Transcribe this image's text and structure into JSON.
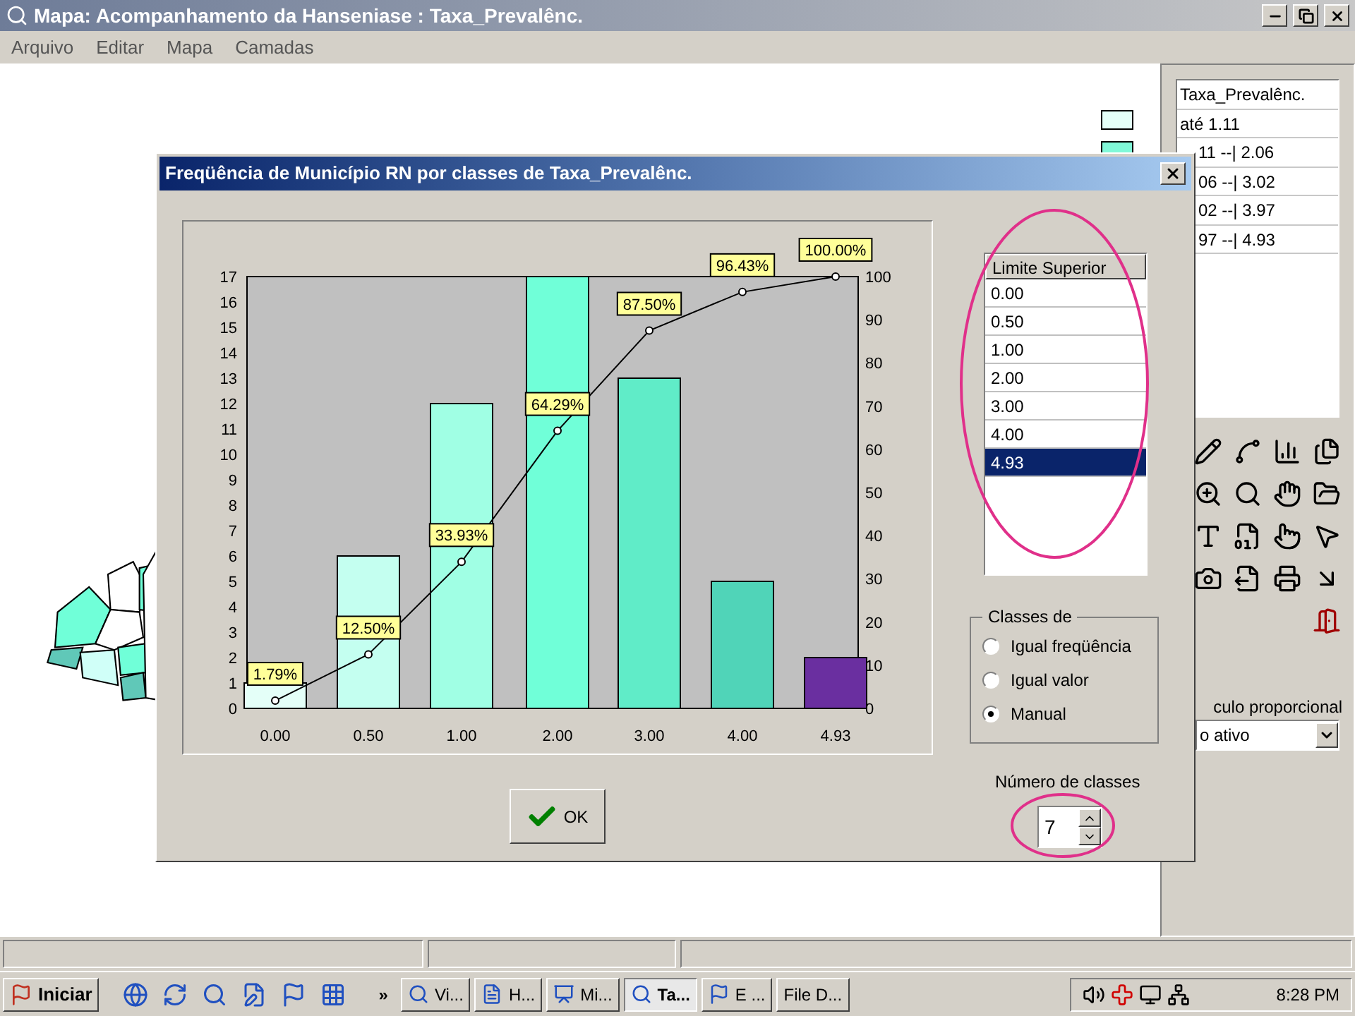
{
  "window": {
    "title": "Mapa: Acompanhamento da Hanseniase : Taxa_Prevalênc."
  },
  "menu": [
    "Arquivo",
    "Editar",
    "Mapa",
    "Camadas"
  ],
  "map_legend": [
    {
      "color": "#e4fff8"
    },
    {
      "color": "#80f8d8"
    }
  ],
  "legend_list": [
    "Taxa_Prevalênc.",
    "até 1.11",
    "11 --| 2.06",
    "06 --| 3.02",
    "02 --| 3.97",
    "97 --| 4.93"
  ],
  "proportional": {
    "label": "culo proporcional",
    "value": "o ativo"
  },
  "dialog": {
    "title": "Freqüência de Município RN por classes de Taxa_Prevalênc.",
    "chart_data": {
      "type": "bar",
      "categories": [
        "0.00",
        "0.50",
        "1.00",
        "2.00",
        "3.00",
        "4.00",
        "4.93"
      ],
      "series": [
        {
          "type": "bar",
          "colors": [
            "#e4fff8",
            "#c4fff0",
            "#a0ffe4",
            "#70ffd8",
            "#60ecc8",
            "#50d4b8",
            "#6a2fa0"
          ],
          "values": [
            1,
            6,
            12,
            17,
            13,
            5,
            2
          ]
        },
        {
          "type": "line",
          "axis": "y2",
          "marker": "circle",
          "color": "#000000",
          "values": [
            1.79,
            12.5,
            33.93,
            64.29,
            87.5,
            96.43,
            100
          ]
        }
      ],
      "ylim": [
        0,
        17
      ],
      "y2lim": [
        0,
        100
      ],
      "yticks": [
        0,
        1,
        2,
        3,
        4,
        5,
        6,
        7,
        8,
        9,
        10,
        11,
        12,
        13,
        14,
        15,
        16,
        17
      ],
      "y2ticks": [
        0,
        10,
        20,
        30,
        40,
        50,
        60,
        70,
        80,
        90,
        100
      ],
      "value_labels": [
        "1.79%",
        "12.50%",
        "33.93%",
        "64.29%",
        "87.50%",
        "96.43%",
        "100.00%"
      ]
    },
    "limits": {
      "header": "Limite Superior",
      "items": [
        {
          "label": "0.00",
          "selected": false
        },
        {
          "label": "0.50",
          "selected": false
        },
        {
          "label": "1.00",
          "selected": false
        },
        {
          "label": "2.00",
          "selected": false
        },
        {
          "label": "3.00",
          "selected": false
        },
        {
          "label": "4.00",
          "selected": false
        },
        {
          "label": "4.93",
          "selected": true
        }
      ]
    },
    "classes": {
      "title": "Classes de",
      "options": [
        {
          "label": "Igual freqüência",
          "selected": false
        },
        {
          "label": "Igual valor",
          "selected": false
        },
        {
          "label": "Manual",
          "selected": true
        }
      ]
    },
    "count": {
      "label": "Número de classes",
      "value": "7"
    },
    "ok": "OK"
  },
  "taskbar": {
    "start": "Iniciar",
    "more": "»",
    "tasks": [
      {
        "label": "Vi...",
        "selected": false
      },
      {
        "label": "H...",
        "selected": false
      },
      {
        "label": "Mi...",
        "selected": false
      },
      {
        "label": "Ta...",
        "selected": true
      },
      {
        "label": "E ...",
        "selected": false
      },
      {
        "label": "File D...",
        "selected": false
      }
    ],
    "clock": "8:28 PM"
  }
}
